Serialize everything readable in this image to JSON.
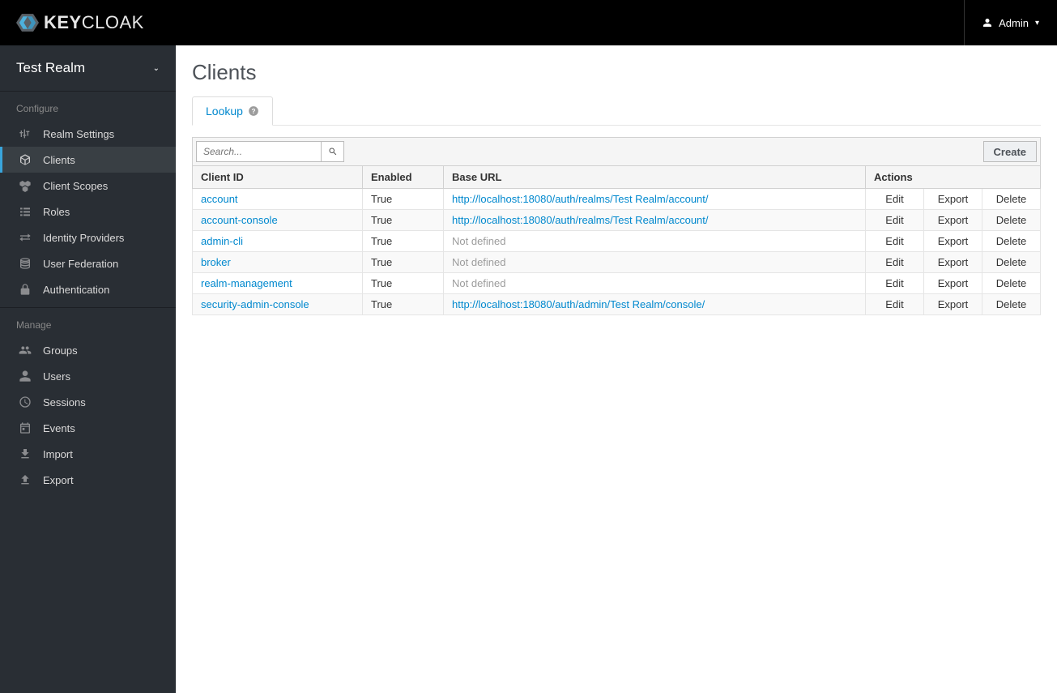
{
  "header": {
    "brand": "KEYCLOAK",
    "user_label": "Admin"
  },
  "sidebar": {
    "realm_name": "Test Realm",
    "configure_label": "Configure",
    "manage_label": "Manage",
    "configure_items": [
      {
        "label": "Realm Settings",
        "icon": "sliders"
      },
      {
        "label": "Clients",
        "icon": "cube",
        "active": true
      },
      {
        "label": "Client Scopes",
        "icon": "cubes"
      },
      {
        "label": "Roles",
        "icon": "list"
      },
      {
        "label": "Identity Providers",
        "icon": "exchange"
      },
      {
        "label": "User Federation",
        "icon": "database"
      },
      {
        "label": "Authentication",
        "icon": "lock"
      }
    ],
    "manage_items": [
      {
        "label": "Groups",
        "icon": "group"
      },
      {
        "label": "Users",
        "icon": "user"
      },
      {
        "label": "Sessions",
        "icon": "clock"
      },
      {
        "label": "Events",
        "icon": "calendar"
      },
      {
        "label": "Import",
        "icon": "import"
      },
      {
        "label": "Export",
        "icon": "export"
      }
    ]
  },
  "page": {
    "title": "Clients",
    "tab_label": "Lookup",
    "search_placeholder": "Search...",
    "create_label": "Create",
    "columns": {
      "client_id": "Client ID",
      "enabled": "Enabled",
      "base_url": "Base URL",
      "actions": "Actions"
    },
    "actions": {
      "edit": "Edit",
      "export": "Export",
      "delete": "Delete"
    },
    "not_defined": "Not defined",
    "rows": [
      {
        "client_id": "account",
        "enabled": "True",
        "base_url": "http://localhost:18080/auth/realms/Test Realm/account/"
      },
      {
        "client_id": "account-console",
        "enabled": "True",
        "base_url": "http://localhost:18080/auth/realms/Test Realm/account/"
      },
      {
        "client_id": "admin-cli",
        "enabled": "True",
        "base_url": null
      },
      {
        "client_id": "broker",
        "enabled": "True",
        "base_url": null
      },
      {
        "client_id": "realm-management",
        "enabled": "True",
        "base_url": null
      },
      {
        "client_id": "security-admin-console",
        "enabled": "True",
        "base_url": "http://localhost:18080/auth/admin/Test Realm/console/"
      }
    ]
  }
}
